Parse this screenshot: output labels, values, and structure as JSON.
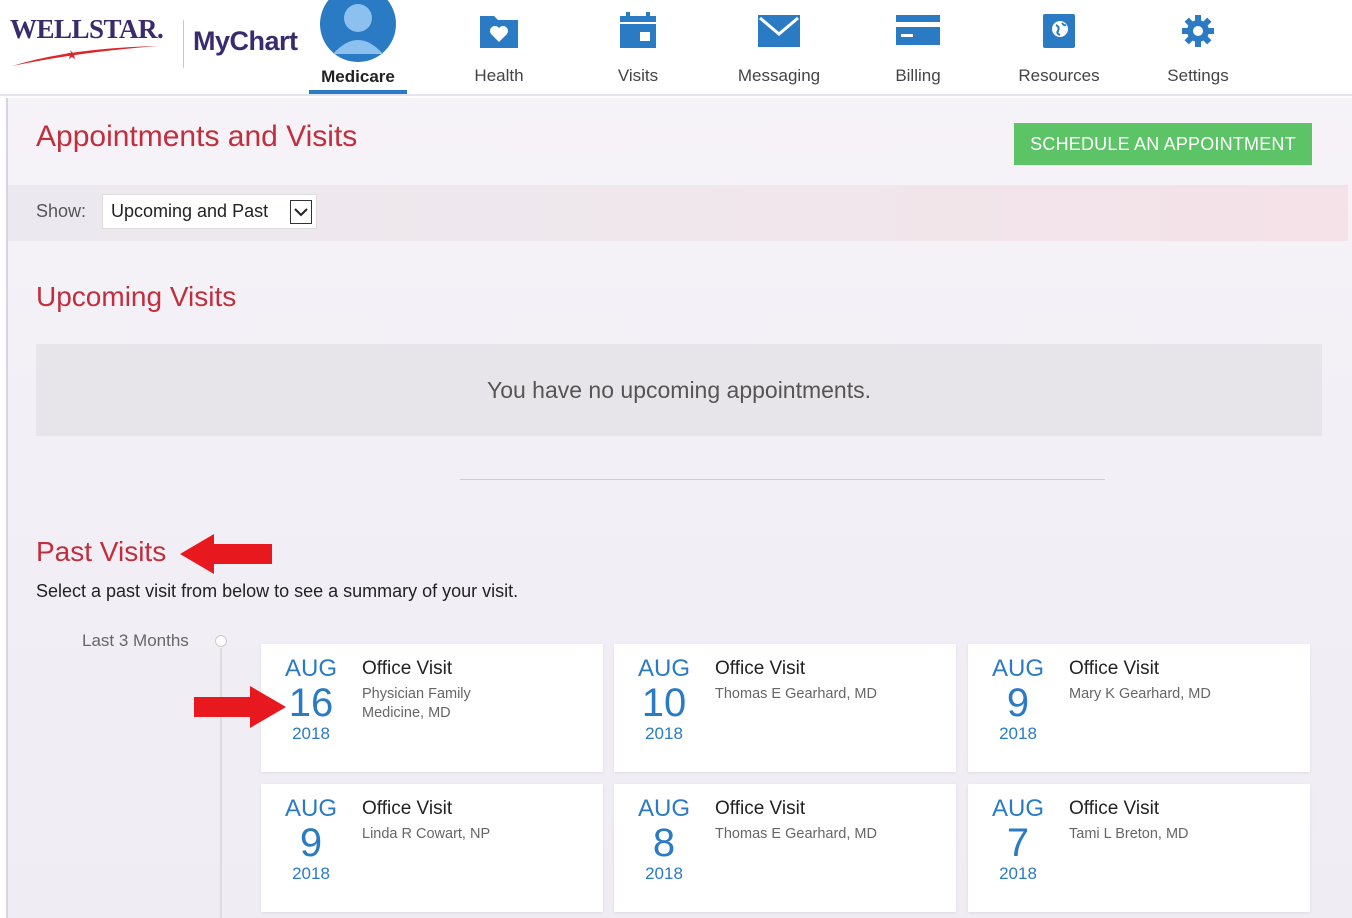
{
  "brand": {
    "wellstar": "WELLSTAR.",
    "mychart": "MyChart"
  },
  "colors": {
    "accent": "#2b7bc4",
    "title_red": "#c12f3d",
    "schedule_green": "#5cc466",
    "brand_purple": "#3a2a6e"
  },
  "nav": {
    "items": [
      {
        "label": "Medicare",
        "icon": "user-avatar-icon",
        "active": true
      },
      {
        "label": "Health",
        "icon": "health-folder-icon"
      },
      {
        "label": "Visits",
        "icon": "calendar-icon"
      },
      {
        "label": "Messaging",
        "icon": "envelope-icon"
      },
      {
        "label": "Billing",
        "icon": "credit-card-icon"
      },
      {
        "label": "Resources",
        "icon": "globe-book-icon"
      },
      {
        "label": "Settings",
        "icon": "gear-icon"
      }
    ]
  },
  "page": {
    "title": "Appointments and Visits",
    "schedule_button": "SCHEDULE AN APPOINTMENT",
    "show_label": "Show:",
    "show_value": "Upcoming and Past"
  },
  "upcoming": {
    "title": "Upcoming Visits",
    "empty_message": "You have no upcoming appointments."
  },
  "past": {
    "title": "Past Visits",
    "description": "Select a past visit from below to see a summary of your visit.",
    "timeline_label": "Last 3 Months",
    "visits": [
      {
        "month": "AUG",
        "day": "16",
        "year": "2018",
        "type": "Office Visit",
        "provider": "Physician Family Medicine, MD"
      },
      {
        "month": "AUG",
        "day": "10",
        "year": "2018",
        "type": "Office Visit",
        "provider": "Thomas E Gearhard, MD"
      },
      {
        "month": "AUG",
        "day": "9",
        "year": "2018",
        "type": "Office Visit",
        "provider": "Mary K Gearhard, MD"
      },
      {
        "month": "AUG",
        "day": "9",
        "year": "2018",
        "type": "Office Visit",
        "provider": "Linda R Cowart, NP"
      },
      {
        "month": "AUG",
        "day": "8",
        "year": "2018",
        "type": "Office Visit",
        "provider": "Thomas E Gearhard, MD"
      },
      {
        "month": "AUG",
        "day": "7",
        "year": "2018",
        "type": "Office Visit",
        "provider": "Tami L Breton, MD"
      }
    ]
  }
}
